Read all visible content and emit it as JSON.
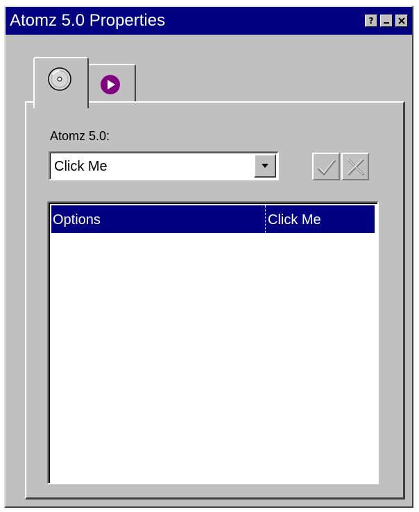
{
  "window": {
    "title": "Atomz 5.0 Properties",
    "help_glyph": "?"
  },
  "tabs": [
    {
      "icon": "cd-disc-icon",
      "selected": true
    },
    {
      "icon": "play-arrow-icon",
      "selected": false,
      "color": "#800080"
    }
  ],
  "form": {
    "label": "Atomz 5.0:",
    "selected_value": "Click Me"
  },
  "list": {
    "columns": [
      "Options",
      "Click Me"
    ]
  },
  "colors": {
    "titlebar": "#000080",
    "face": "#c0c0c0",
    "selection": "#000080"
  }
}
